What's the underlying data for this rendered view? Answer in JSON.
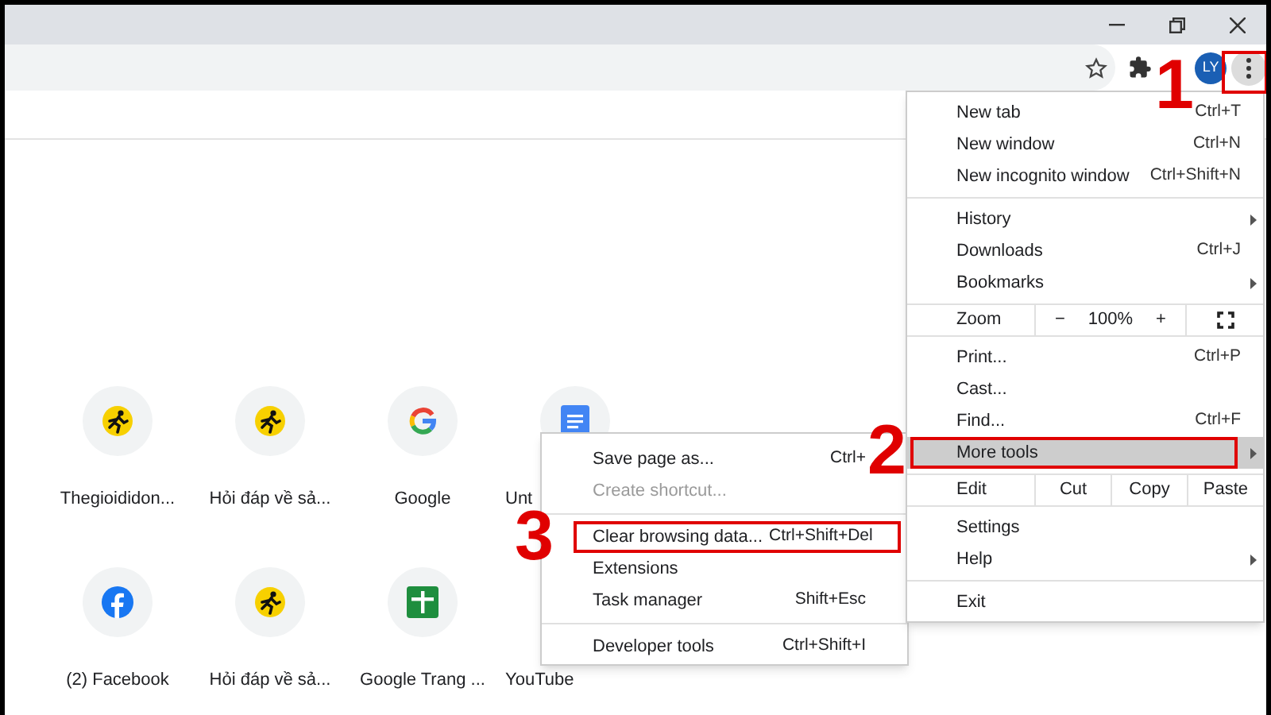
{
  "toolbar": {
    "avatar": "LY",
    "menu_button": {
      "outlined": true
    }
  },
  "shortcuts": [
    {
      "label": "Thegioididon...",
      "kind": "runner"
    },
    {
      "label": "Hỏi đáp về sả...",
      "kind": "runner"
    },
    {
      "label": "Google",
      "kind": "google"
    },
    {
      "label": "Unt",
      "kind": "docs"
    },
    {
      "label": "(2) Facebook",
      "kind": "facebook"
    },
    {
      "label": "Hỏi đáp về sả...",
      "kind": "runner"
    },
    {
      "label": "Google Trang ...",
      "kind": "sheets"
    },
    {
      "label": "YouTube",
      "kind": "covered"
    }
  ],
  "main_menu": [
    {
      "kind": "item",
      "label": "New tab",
      "shortcut": "Ctrl+T",
      "submenu": false,
      "selected": false,
      "outlined": false
    },
    {
      "kind": "item",
      "label": "New window",
      "shortcut": "Ctrl+N",
      "submenu": false,
      "selected": false,
      "outlined": false
    },
    {
      "kind": "item",
      "label": "New incognito window",
      "shortcut": "Ctrl+Shift+N",
      "submenu": false,
      "selected": false,
      "outlined": false
    },
    {
      "kind": "separator"
    },
    {
      "kind": "item",
      "label": "History",
      "submenu": true,
      "selected": false,
      "outlined": false
    },
    {
      "kind": "item",
      "label": "Downloads",
      "shortcut": "Ctrl+J",
      "submenu": false,
      "selected": false,
      "outlined": false
    },
    {
      "kind": "item",
      "label": "Bookmarks",
      "submenu": true,
      "selected": false,
      "outlined": false
    },
    {
      "kind": "zoom",
      "label": "Zoom",
      "minus": "−",
      "value": "100%",
      "plus": "+"
    },
    {
      "kind": "item",
      "label": "Print...",
      "shortcut": "Ctrl+P",
      "submenu": false,
      "selected": false,
      "outlined": false
    },
    {
      "kind": "item",
      "label": "Cast...",
      "submenu": false,
      "selected": false,
      "outlined": false
    },
    {
      "kind": "item",
      "label": "Find...",
      "shortcut": "Ctrl+F",
      "submenu": false,
      "selected": false,
      "outlined": false
    },
    {
      "kind": "item",
      "label": "More tools",
      "submenu": true,
      "selected": true,
      "outlined": true
    },
    {
      "kind": "edit",
      "label": "Edit",
      "actions": [
        "Cut",
        "Copy",
        "Paste"
      ]
    },
    {
      "kind": "item",
      "label": "Settings",
      "submenu": false,
      "selected": false,
      "outlined": false
    },
    {
      "kind": "item",
      "label": "Help",
      "submenu": true,
      "selected": false,
      "outlined": false
    },
    {
      "kind": "separator"
    },
    {
      "kind": "item",
      "label": "Exit",
      "submenu": false,
      "selected": false,
      "outlined": false
    }
  ],
  "submenu": [
    {
      "kind": "item",
      "label": "Save page as...",
      "shortcut": "Ctrl+",
      "disabled": false,
      "outlined": false
    },
    {
      "kind": "item",
      "label": "Create shortcut...",
      "disabled": true,
      "outlined": false
    },
    {
      "kind": "separator"
    },
    {
      "kind": "item",
      "label": "Clear browsing data...",
      "shortcut": "Ctrl+Shift+Del",
      "disabled": false,
      "outlined": true
    },
    {
      "kind": "item",
      "label": "Extensions",
      "disabled": false,
      "outlined": false
    },
    {
      "kind": "item",
      "label": "Task manager",
      "shortcut": "Shift+Esc",
      "disabled": false,
      "outlined": false
    },
    {
      "kind": "separator"
    },
    {
      "kind": "item",
      "label": "Developer tools",
      "shortcut": "Ctrl+Shift+I",
      "disabled": false,
      "outlined": false
    }
  ],
  "callouts": [
    "1",
    "2",
    "3"
  ]
}
